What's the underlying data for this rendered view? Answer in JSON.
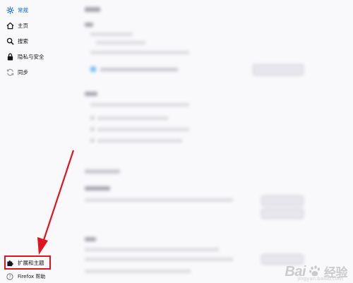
{
  "sidebar": {
    "items": [
      {
        "label": "常规",
        "icon": "gear-icon",
        "state": "active"
      },
      {
        "label": "主页",
        "icon": "home-icon",
        "state": "normal"
      },
      {
        "label": "搜索",
        "icon": "search-icon",
        "state": "normal"
      },
      {
        "label": "隐私与安全",
        "icon": "lock-icon",
        "state": "normal"
      },
      {
        "label": "同步",
        "icon": "sync-icon",
        "state": "muted"
      }
    ],
    "footer": [
      {
        "label": "扩展和主题",
        "icon": "puzzle-icon"
      },
      {
        "label": "Firefox 帮助",
        "icon": "help-icon"
      }
    ]
  },
  "watermark": {
    "text": "Bai",
    "text2": "经验",
    "sub": "jingyan.baidu.com"
  },
  "colors": {
    "accent": "#0061e0",
    "highlight": "#e0141f",
    "arrow": "#e0141f"
  }
}
